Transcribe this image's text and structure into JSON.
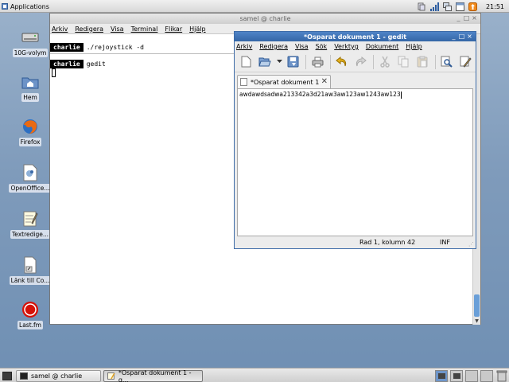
{
  "top_panel": {
    "applications_label": "Applications",
    "clock": "21:51",
    "tray_icons": [
      "network-icon",
      "signal-bars-icon",
      "network-manager-icon",
      "window-icon",
      "update-notifier-icon"
    ]
  },
  "desktop_icons": [
    {
      "name": "drive-icon",
      "label": "10G-volym"
    },
    {
      "name": "home-folder-icon",
      "label": "Hem"
    },
    {
      "name": "firefox-icon",
      "label": "Firefox"
    },
    {
      "name": "openoffice-icon",
      "label": "OpenOffice..."
    },
    {
      "name": "text-editor-icon",
      "label": "Textredige..."
    },
    {
      "name": "link-icon",
      "label": "Länk till Co..."
    },
    {
      "name": "lastfm-icon",
      "label": "Last.fm"
    }
  ],
  "terminal": {
    "title": "samel @ charlie",
    "menu": [
      "Arkiv",
      "Redigera",
      "Visa",
      "Terminal",
      "Flikar",
      "Hjälp"
    ],
    "lines": [
      {
        "user": "charlie",
        "command": "./rejoystick -d"
      },
      {
        "user": "charlie",
        "command": "gedit"
      }
    ]
  },
  "gedit": {
    "title": "*Osparat dokument 1 - gedit",
    "menu": [
      "Arkiv",
      "Redigera",
      "Visa",
      "Sök",
      "Verktyg",
      "Dokument",
      "Hjälp"
    ],
    "toolbar": [
      "new-document-icon",
      "open-icon",
      "open-dropdown-icon",
      "save-icon",
      "print-icon",
      "undo-icon",
      "redo-icon",
      "cut-icon",
      "copy-icon",
      "paste-icon",
      "find-icon",
      "replace-icon"
    ],
    "tab_label": "*Osparat dokument 1",
    "content": "awdawdsadwa213342a3d21aw3aw123aw1243aw123",
    "status_position": "Rad 1, kolumn 42",
    "status_mode": "INF"
  },
  "bottom_panel": {
    "tasks": [
      {
        "label": "samel @ charlie",
        "active": false
      },
      {
        "label": "*Osparat dokument 1 - g...",
        "active": true
      }
    ],
    "workspaces": 4
  }
}
